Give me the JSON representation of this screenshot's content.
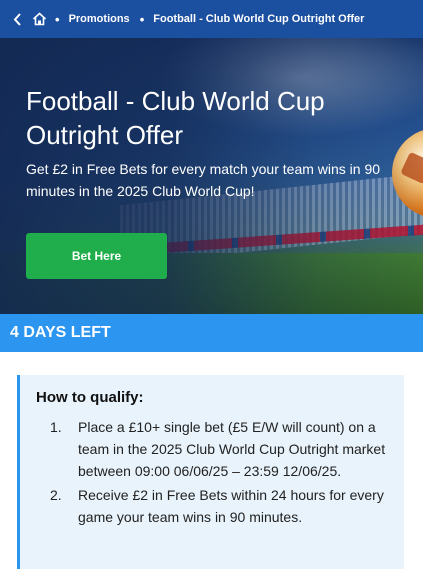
{
  "breadcrumb": {
    "back_icon": "chevron-left-icon",
    "home_icon": "home-icon",
    "separator": "•",
    "promotions": "Promotions",
    "current": "Football - Club World Cup Outright Offer"
  },
  "hero": {
    "title": "Football - Club World Cup Outright Offer",
    "subtitle": "Get £2 in Free Bets for every match your team wins in 90 minutes in the 2025 Club World Cup!",
    "button_label": "Bet Here"
  },
  "countdown": {
    "label": "4 DAYS LEFT"
  },
  "qualify": {
    "title": "How to qualify:",
    "steps": [
      {
        "num": "1.",
        "text": "Place a £10+ single bet (£5 E/W will count) on a team in the 2025 Club World Cup Outright market between 09:00 06/06/25 – 23:59 12/06/25."
      },
      {
        "num": "2.",
        "text": "Receive £2 in Free Bets within 24 hours for every game your team wins in 90 minutes."
      }
    ]
  },
  "colors": {
    "nav_bg": "#1b4fa0",
    "button_green": "#1fae4b",
    "accent_blue": "#2b95ef",
    "qualify_bg": "#e8f3fb"
  }
}
